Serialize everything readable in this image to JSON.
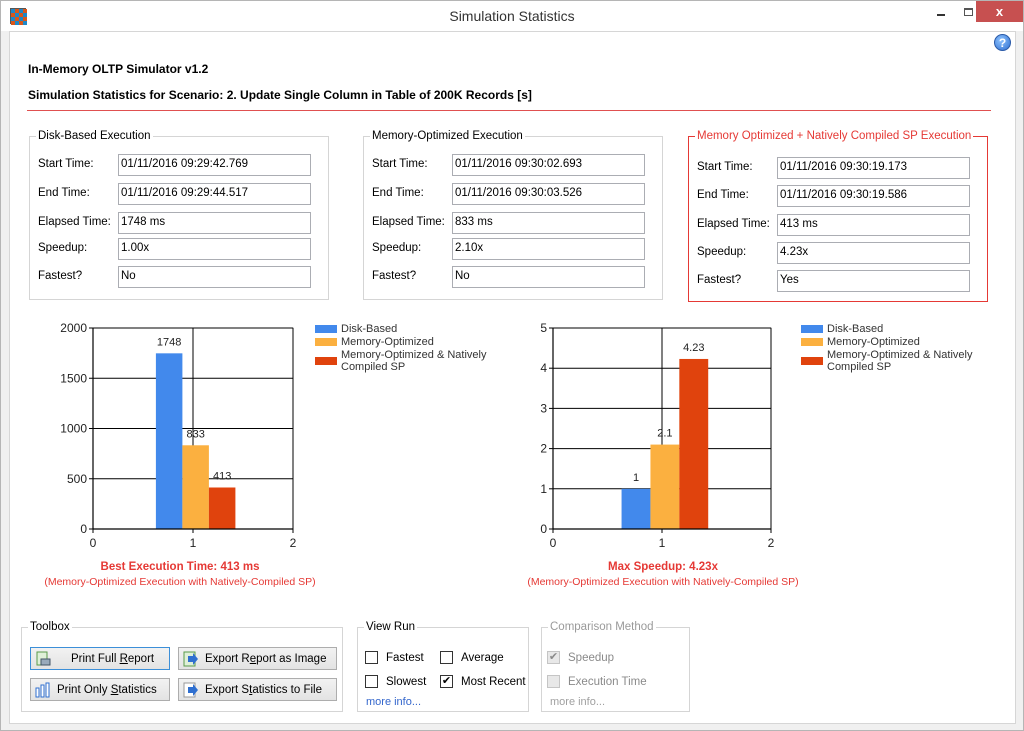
{
  "window": {
    "title": "Simulation Statistics",
    "close_label": "x"
  },
  "header": {
    "app_name": "In-Memory OLTP Simulator v1.2",
    "scenario": "Simulation Statistics for Scenario: 2. Update Single Column in Table of 200K Records [s]"
  },
  "field_labels": {
    "start": "Start Time:",
    "end": "End Time:",
    "elapsed": "Elapsed Time:",
    "speedup": "Speedup:",
    "fastest": "Fastest?"
  },
  "groups": [
    {
      "title": "Disk-Based Execution",
      "start_time": "01/11/2016 09:29:42.769",
      "end_time": "01/11/2016 09:29:44.517",
      "elapsed": "1748 ms",
      "speedup": "1.00x",
      "fastest": "No"
    },
    {
      "title": "Memory-Optimized Execution",
      "start_time": "01/11/2016 09:30:02.693",
      "end_time": "01/11/2016 09:30:03.526",
      "elapsed": "833 ms",
      "speedup": "2.10x",
      "fastest": "No"
    },
    {
      "title": "Memory Optimized + Natively Compiled  SP Execution",
      "start_time": "01/11/2016 09:30:19.173",
      "end_time": "01/11/2016 09:30:19.586",
      "elapsed": "413 ms",
      "speedup": "4.23x",
      "fastest": "Yes"
    }
  ],
  "colors": {
    "disk": "#4289ec",
    "memory": "#fbb040",
    "native": "#e0430d",
    "highlight": "#e53935"
  },
  "chart_data": [
    {
      "type": "bar",
      "title": "",
      "xlabel": "",
      "ylabel": "",
      "xlim": [
        0,
        2
      ],
      "x_ticks": [
        "0",
        "1",
        "2"
      ],
      "ylim": [
        0,
        2000
      ],
      "y_ticks": [
        "0",
        "500",
        "1000",
        "1500",
        "2000"
      ],
      "grid": true,
      "legend": "right",
      "series": [
        {
          "name": "Disk-Based",
          "values": [
            1748
          ],
          "label": "1748"
        },
        {
          "name": "Memory-Optimized",
          "values": [
            833
          ],
          "label": "833"
        },
        {
          "name": "Memory-Optimized & Natively Compiled SP",
          "values": [
            413
          ],
          "label": "413"
        }
      ],
      "caption": "Best Execution Time: 413 ms",
      "subcaption": "(Memory-Optimized Execution with Natively-Compiled SP)"
    },
    {
      "type": "bar",
      "title": "",
      "xlabel": "",
      "ylabel": "",
      "xlim": [
        0,
        2
      ],
      "x_ticks": [
        "0",
        "1",
        "2"
      ],
      "ylim": [
        0,
        5
      ],
      "y_ticks": [
        "0",
        "1",
        "2",
        "3",
        "4",
        "5"
      ],
      "grid": true,
      "legend": "right",
      "series": [
        {
          "name": "Disk-Based",
          "values": [
            1
          ],
          "label": "1"
        },
        {
          "name": "Memory-Optimized",
          "values": [
            2.1
          ],
          "label": "2.1"
        },
        {
          "name": "Memory-Optimized & Natively Compiled SP",
          "values": [
            4.23
          ],
          "label": "4.23"
        }
      ],
      "caption": "Max Speedup: 4.23x",
      "subcaption": "(Memory-Optimized Execution with Natively-Compiled SP)"
    }
  ],
  "legend_items": [
    {
      "label": "Disk-Based"
    },
    {
      "label": "Memory-Optimized"
    },
    {
      "label": "Memory-Optimized & Natively Compiled SP"
    }
  ],
  "toolbox": {
    "title": "Toolbox",
    "print_full": {
      "pre": "Print Full ",
      "ul": "R",
      "post": "eport"
    },
    "export_image": {
      "pre": "Export R",
      "ul": "e",
      "post": "port as Image"
    },
    "print_stats": {
      "pre": "Print Only ",
      "ul": "S",
      "post": "tatistics"
    },
    "export_stats": {
      "pre": "Export S",
      "ul": "t",
      "post": "atistics to File"
    }
  },
  "view_run": {
    "title": "View Run",
    "options": [
      {
        "label": "Fastest",
        "checked": false
      },
      {
        "label": "Average",
        "checked": false
      },
      {
        "label": "Slowest",
        "checked": false
      },
      {
        "label": "Most Recent",
        "checked": true
      }
    ],
    "more_info": "more info..."
  },
  "comparison": {
    "title": "Comparison Method",
    "options": [
      {
        "label": "Speedup",
        "checked": true
      },
      {
        "label": "Execution Time",
        "checked": false
      }
    ],
    "more_info": "more info..."
  }
}
